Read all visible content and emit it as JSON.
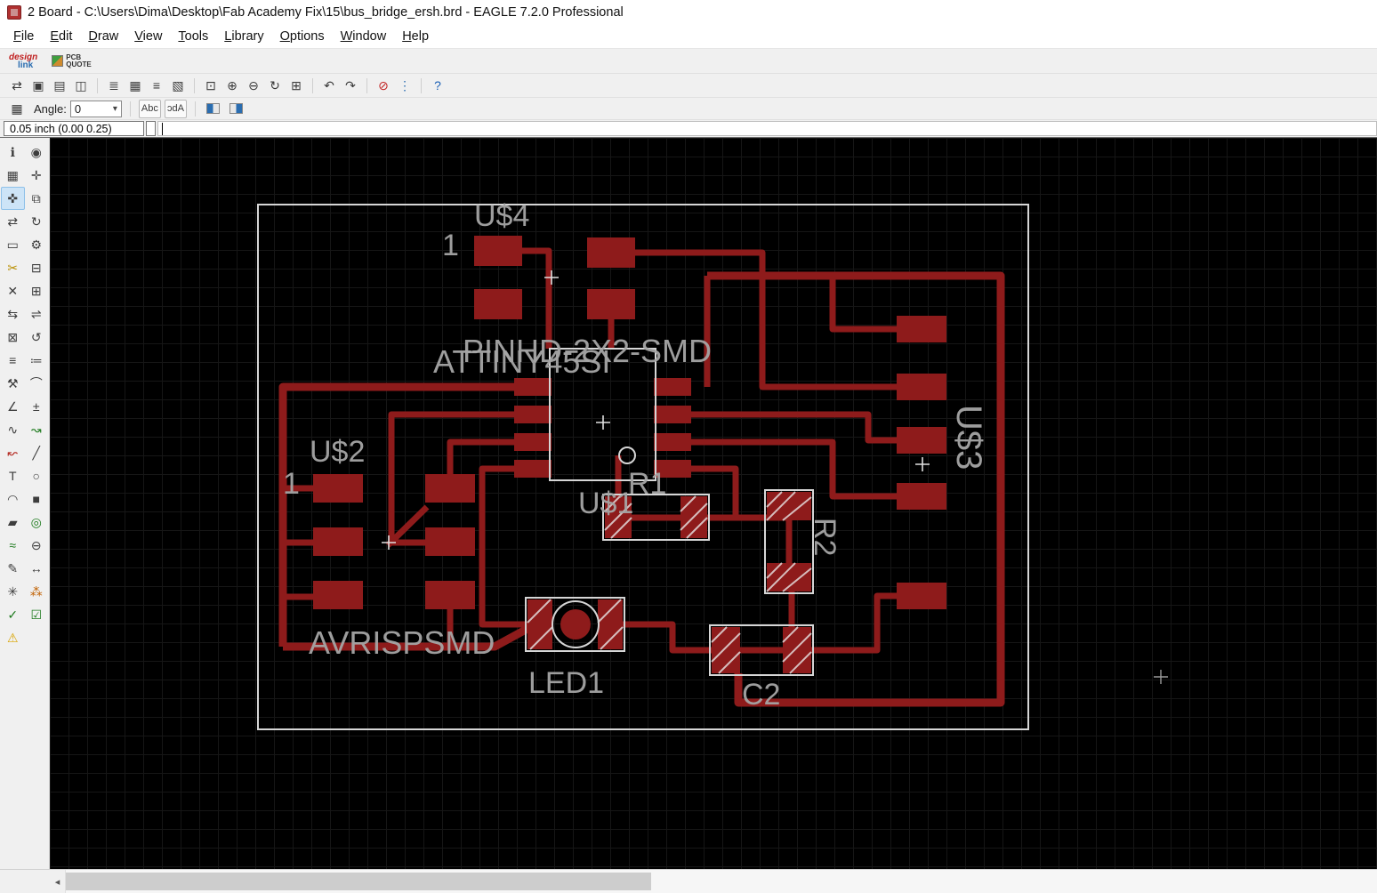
{
  "window": {
    "title": "2 Board - C:\\Users\\Dima\\Desktop\\Fab Academy Fix\\15\\bus_bridge_ersh.brd - EAGLE 7.2.0 Professional"
  },
  "menu": {
    "items": [
      "File",
      "Edit",
      "Draw",
      "View",
      "Tools",
      "Library",
      "Options",
      "Window",
      "Help"
    ]
  },
  "branding": {
    "design": "design",
    "link": "link",
    "pcb": "PCB",
    "quote": "QUOTE"
  },
  "toolbar_main": {
    "buttons": [
      {
        "name": "open-board-schematic",
        "glyph": "⇄"
      },
      {
        "name": "save",
        "glyph": "▣"
      },
      {
        "name": "print",
        "glyph": "▤"
      },
      {
        "name": "cam-processor",
        "glyph": "◫"
      },
      {
        "type": "sep"
      },
      {
        "name": "load-ulp",
        "glyph": "≣"
      },
      {
        "name": "layer-settings",
        "glyph": "▦"
      },
      {
        "name": "run-script",
        "glyph": "≡"
      },
      {
        "name": "export-image",
        "glyph": "▧"
      },
      {
        "type": "sep"
      },
      {
        "name": "zoom-fit",
        "glyph": "⊡"
      },
      {
        "name": "zoom-in",
        "glyph": "⊕"
      },
      {
        "name": "zoom-out",
        "glyph": "⊖"
      },
      {
        "name": "zoom-redraw",
        "glyph": "↻"
      },
      {
        "name": "zoom-select",
        "glyph": "⊞"
      },
      {
        "type": "sep"
      },
      {
        "name": "undo",
        "glyph": "↶"
      },
      {
        "name": "redo",
        "glyph": "↷"
      },
      {
        "type": "sep"
      },
      {
        "name": "stop",
        "glyph": "⊘",
        "color": "#c22222"
      },
      {
        "name": "go",
        "glyph": "⋮",
        "color": "#2a6db0"
      },
      {
        "type": "sep"
      },
      {
        "name": "help",
        "glyph": "?",
        "color": "#1a5fb4"
      }
    ]
  },
  "toolbar_params": {
    "angle_label": "Angle:",
    "angle_value": "0",
    "text_btn": "Abc",
    "text_mirror_btn": "Abc"
  },
  "command_bar": {
    "coord_display": "0.05 inch (0.00 0.25)",
    "command_value": ""
  },
  "tool_palette": {
    "items": [
      {
        "name": "info",
        "glyph": "ℹ"
      },
      {
        "name": "show",
        "glyph": "◉"
      },
      {
        "name": "display",
        "glyph": "▦"
      },
      {
        "name": "mark",
        "glyph": "✛"
      },
      {
        "name": "move",
        "glyph": "✜",
        "selected": true
      },
      {
        "name": "copy",
        "glyph": "⧉"
      },
      {
        "name": "mirror",
        "glyph": "⇄"
      },
      {
        "name": "rotate",
        "glyph": "↻"
      },
      {
        "name": "group",
        "glyph": "▭"
      },
      {
        "name": "change",
        "glyph": "⚙"
      },
      {
        "name": "cut",
        "glyph": "✂",
        "color": "#b98f00"
      },
      {
        "name": "paste",
        "glyph": "⊟"
      },
      {
        "name": "delete",
        "glyph": "✕"
      },
      {
        "name": "add",
        "glyph": "⊞"
      },
      {
        "name": "pinswap",
        "glyph": "⇆"
      },
      {
        "name": "replace",
        "glyph": "⇌"
      },
      {
        "name": "lock",
        "glyph": "⊠"
      },
      {
        "name": "spin",
        "glyph": "↺"
      },
      {
        "name": "name",
        "glyph": "≡"
      },
      {
        "name": "value",
        "glyph": "≔"
      },
      {
        "name": "smash",
        "glyph": "⚒"
      },
      {
        "name": "miter",
        "glyph": "⌒"
      },
      {
        "name": "split",
        "glyph": "∠"
      },
      {
        "name": "optimize",
        "glyph": "±"
      },
      {
        "name": "meander",
        "glyph": "∿"
      },
      {
        "name": "route",
        "glyph": "↝",
        "color": "#1d7a1d"
      },
      {
        "name": "ripup",
        "glyph": "↜",
        "color": "#b3261e"
      },
      {
        "name": "wire",
        "glyph": "╱"
      },
      {
        "name": "text",
        "glyph": "T"
      },
      {
        "name": "circle",
        "glyph": "○"
      },
      {
        "name": "arc",
        "glyph": "◠"
      },
      {
        "name": "rect",
        "glyph": "■"
      },
      {
        "name": "polygon",
        "glyph": "▰"
      },
      {
        "name": "via",
        "glyph": "◎",
        "color": "#1d7a1d"
      },
      {
        "name": "signal",
        "glyph": "≈",
        "color": "#1d7a1d"
      },
      {
        "name": "hole",
        "glyph": "⊖"
      },
      {
        "name": "attribute",
        "glyph": "✎"
      },
      {
        "name": "dimension",
        "glyph": "↔"
      },
      {
        "name": "ratsnest",
        "glyph": "✳"
      },
      {
        "name": "autoroute",
        "glyph": "⁂",
        "color": "#c06000"
      },
      {
        "name": "drc",
        "glyph": "✓",
        "color": "#1d7a1d"
      },
      {
        "name": "errors",
        "glyph": "☑",
        "color": "#1d7a1d"
      },
      {
        "name": "warning",
        "glyph": "⚠",
        "color": "#d9a400"
      },
      {
        "type": "blank",
        "glyph": ""
      }
    ]
  },
  "canvas": {
    "labels": {
      "u4": "U$4",
      "u4_pin1": "1",
      "pinhd": "PINHD-2X2-SMD",
      "attiny": "ATTINY45SI",
      "u2": "U$2",
      "u2_pin1": "1",
      "u1": "U$1",
      "r1": "R1",
      "r2": "R2",
      "c2": "C2",
      "led1": "LED1",
      "avrisp": "AVRISPSMD",
      "u3": "U$3"
    },
    "colors": {
      "copper": "#8e1b1b",
      "silkscreen": "#d6d6d6",
      "label": "#a6a6a6",
      "background": "#000000",
      "grid": "#161616"
    }
  }
}
